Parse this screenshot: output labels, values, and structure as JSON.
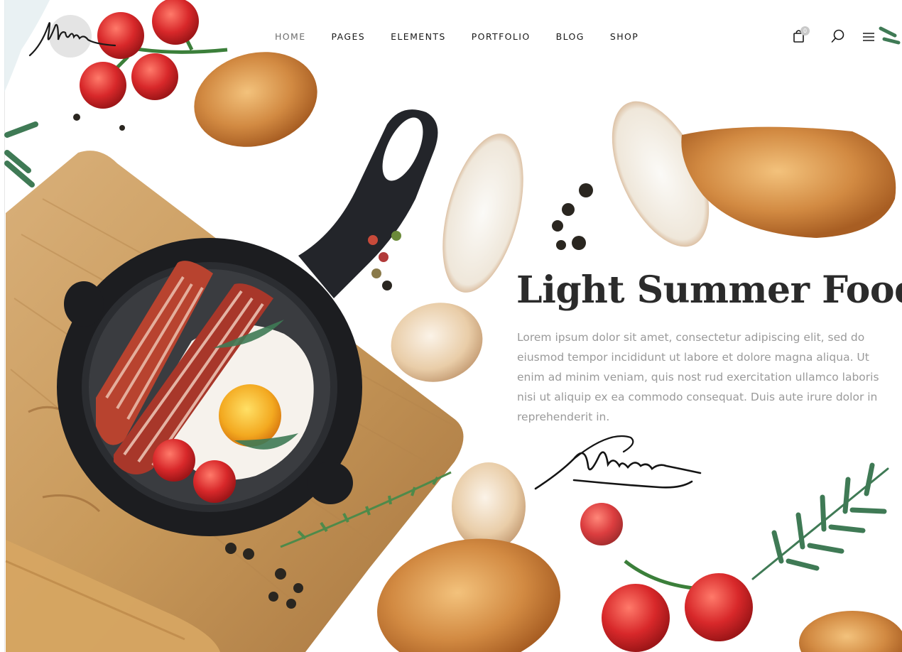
{
  "nav": {
    "items": [
      {
        "label": "HOME",
        "active": true
      },
      {
        "label": "PAGES",
        "active": false
      },
      {
        "label": "ELEMENTS",
        "active": false
      },
      {
        "label": "PORTFOLIO",
        "active": false
      },
      {
        "label": "BLOG",
        "active": false
      },
      {
        "label": "SHOP",
        "active": false
      }
    ]
  },
  "header": {
    "cart_count": "0",
    "icons": [
      "shopping-bag-icon",
      "search-icon",
      "hamburger-menu-icon"
    ]
  },
  "hero": {
    "title": "Light Summer Food",
    "body": "Lorem ipsum dolor sit amet, consectetur adipiscing elit, sed do eiusmod tempor incididunt ut labore et dolore magna aliqua. Ut enim ad minim veniam, quis nost rud exercitation ullamco laboris nisi ut aliquip ex ea commodo consequat. Duis aute irure dolor in reprehenderit in."
  },
  "colors": {
    "title": "#2b2b2b",
    "body_text": "#9a9a9a",
    "nav_text": "#1a1a1a",
    "nav_active": "#6e6e6e",
    "cutting_board": "#c9995a",
    "pan": "#1e1f21",
    "tomato": "#d42a2a",
    "bread": "#c9833e",
    "herb": "#3f7a55"
  }
}
